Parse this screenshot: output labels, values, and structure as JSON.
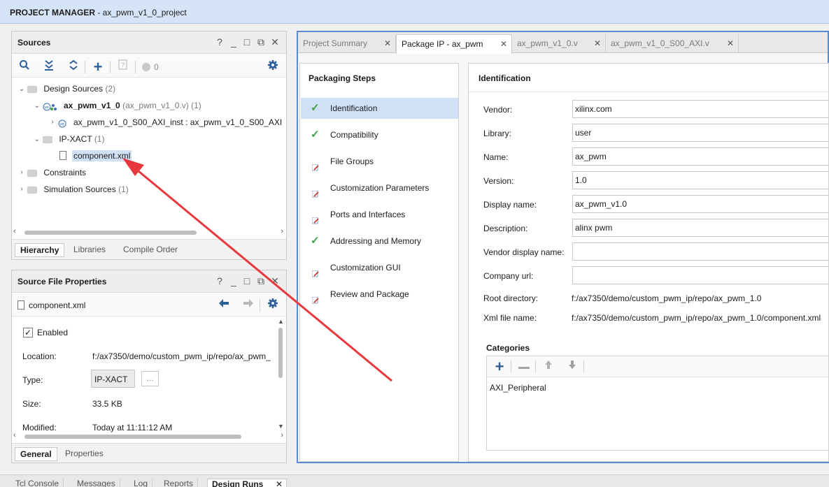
{
  "titlebar": {
    "section": "PROJECT MANAGER",
    "project": " - ax_pwm_v1_0_project"
  },
  "sources": {
    "title": "Sources",
    "controls": [
      "?",
      "_",
      "□",
      "⧉",
      "✕"
    ],
    "toolbar": {
      "count": "0"
    },
    "tree": {
      "design_sources": {
        "label": "Design Sources",
        "count": "(2)"
      },
      "top": {
        "name": "ax_pwm_v1_0",
        "file": "(ax_pwm_v1_0.v)",
        "count": "(1)"
      },
      "child": {
        "label": "ax_pwm_v1_0_S00_AXI_inst : ax_pwm_v1_0_S00_AXI"
      },
      "ipxact": {
        "label": "IP-XACT",
        "count": "(1)"
      },
      "component": {
        "label": "component.xml"
      },
      "constraints": {
        "label": "Constraints"
      },
      "sim": {
        "label": "Simulation Sources",
        "count": "(1)"
      }
    },
    "tabs": [
      "Hierarchy",
      "Libraries",
      "Compile Order"
    ]
  },
  "props": {
    "title": "Source File Properties",
    "file": "component.xml",
    "enabled_label": "Enabled",
    "location_label": "Location:",
    "location_value": "f:/ax7350/demo/custom_pwm_ip/repo/ax_pwm_",
    "type_label": "Type:",
    "type_value": "IP-XACT",
    "type_button": "...",
    "size_label": "Size:",
    "size_value": "33.5 KB",
    "modified_label": "Modified:",
    "modified_value": "Today at 11:11:12 AM",
    "tabs": [
      "General",
      "Properties"
    ]
  },
  "editor": {
    "tabs": [
      {
        "label": "Project Summary"
      },
      {
        "label": "Package IP - ax_pwm"
      },
      {
        "label": "ax_pwm_v1_0.v"
      },
      {
        "label": "ax_pwm_v1_0_S00_AXI.v"
      }
    ],
    "close": "✕",
    "steps_title": "Packaging Steps",
    "steps": [
      {
        "label": "Identification"
      },
      {
        "label": "Compatibility"
      },
      {
        "label": "File Groups"
      },
      {
        "label": "Customization Parameters"
      },
      {
        "label": "Ports and Interfaces"
      },
      {
        "label": "Addressing and Memory"
      },
      {
        "label": "Customization GUI"
      },
      {
        "label": "Review and Package"
      }
    ],
    "ident_title": "Identification",
    "fields": {
      "vendor_label": "Vendor:",
      "vendor": "xilinx.com",
      "library_label": "Library:",
      "library": "user",
      "name_label": "Name:",
      "name": "ax_pwm",
      "version_label": "Version:",
      "version": "1.0",
      "display_label": "Display name:",
      "display": "ax_pwm_v1.0",
      "desc_label": "Description:",
      "desc": "alinx pwm",
      "vdisp_label": "Vendor display name:",
      "vdisp": "",
      "url_label": "Company url:",
      "url": "",
      "root_label": "Root directory:",
      "root": "f:/ax7350/demo/custom_pwm_ip/repo/ax_pwm_1.0",
      "xml_label": "Xml file name:",
      "xml": "f:/ax7350/demo/custom_pwm_ip/repo/ax_pwm_1.0/component.xml"
    },
    "categories_title": "Categories",
    "categories": [
      "AXI_Peripheral"
    ]
  },
  "bottom_tabs": [
    "Tcl Console",
    "Messages",
    "Log",
    "Reports",
    "Design Runs"
  ],
  "colors": {
    "accent": "#5b8ad0",
    "selection": "#cfe0f7",
    "check": "#3fa23f",
    "arrow": "#e8383d"
  }
}
